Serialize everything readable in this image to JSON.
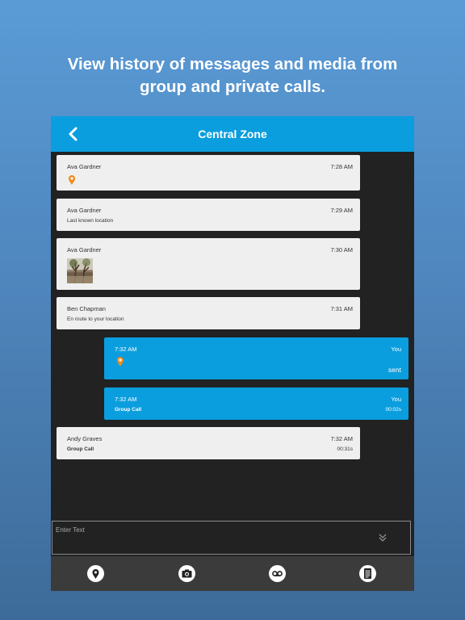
{
  "headline": {
    "line1": "View history of messages and media from",
    "line2": "group and private calls."
  },
  "header": {
    "title": "Central Zone",
    "back_icon": "chevron-left-icon"
  },
  "messages": [
    {
      "direction": "in",
      "sender": "Ava Gardner",
      "time": "7:28 AM",
      "kind": "location"
    },
    {
      "direction": "in",
      "sender": "Ava Gardner",
      "time": "7:29 AM",
      "text": "Last known location"
    },
    {
      "direction": "in",
      "sender": "Ava Gardner",
      "time": "7:30 AM",
      "kind": "image"
    },
    {
      "direction": "in",
      "sender": "Ben Chapman",
      "time": "7:31 AM",
      "text": "En route to your location"
    },
    {
      "direction": "out",
      "sender": "You",
      "time": "7:32 AM",
      "kind": "location",
      "status": "sent"
    },
    {
      "direction": "out",
      "sender": "You",
      "time": "7:32 AM",
      "text": "Group Call",
      "duration": "00:02s"
    },
    {
      "direction": "in",
      "sender": "Andy Graves",
      "time": "7:32 AM",
      "text": "Group Call",
      "duration": "00:31s"
    }
  ],
  "composer": {
    "placeholder": "Enter Text",
    "expand_icon": "double-chevron-down-icon"
  },
  "toolbar": [
    {
      "name": "location-pin-icon"
    },
    {
      "name": "camera-icon"
    },
    {
      "name": "voicemail-icon"
    },
    {
      "name": "document-icon"
    }
  ],
  "colors": {
    "accent": "#0a9ede",
    "background_dark": "#222222",
    "bubble_in": "#efefef",
    "pin_orange": "#f08a1c"
  }
}
